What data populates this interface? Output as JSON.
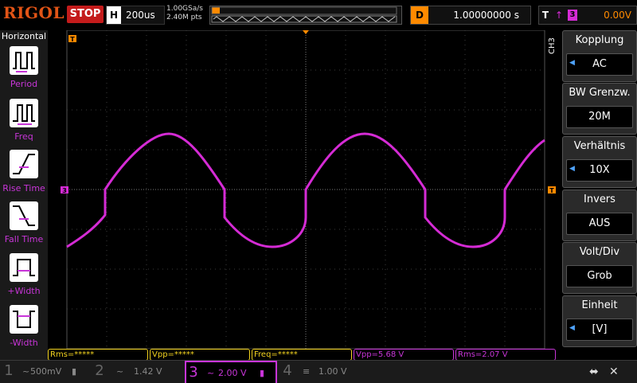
{
  "topbar": {
    "logo": "RIGOL",
    "run_state": "STOP",
    "timebase_key": "H",
    "timebase_value": "200us",
    "sample_rate": "1.00GSa/s",
    "memory_depth": "2.40M pts",
    "delay_key": "D",
    "delay_value": "1.00000000 s",
    "trigger_key": "T",
    "trigger_source": "3",
    "trigger_level": "0.00V"
  },
  "left_panel": {
    "title": "Horizontal",
    "items": [
      {
        "label": "Period",
        "icon": "period-icon"
      },
      {
        "label": "Freq",
        "icon": "freq-icon"
      },
      {
        "label": "Rise Time",
        "icon": "rise-time-icon"
      },
      {
        "label": "Fall Time",
        "icon": "fall-time-icon"
      },
      {
        "label": "+Width",
        "icon": "pos-width-icon"
      },
      {
        "label": "-Width",
        "icon": "neg-width-icon"
      }
    ]
  },
  "right_menu": {
    "channel_label": "CH3",
    "items": [
      {
        "title": "Kopplung",
        "value": "AC"
      },
      {
        "title": "BW Grenzw.",
        "value": "20M"
      },
      {
        "title": "Verhältnis",
        "value": "10X"
      },
      {
        "title": "Invers",
        "value": "AUS"
      },
      {
        "title": "Volt/Div",
        "value": "Grob"
      },
      {
        "title": "Einheit",
        "value": "[V]"
      }
    ]
  },
  "measurements": [
    {
      "text": "Rms=*****",
      "color": "#f2d21f"
    },
    {
      "text": "Vpp=*****",
      "color": "#f2d21f"
    },
    {
      "text": "Freq=*****",
      "color": "#f2d21f"
    },
    {
      "text": "Vpp=5.68 V",
      "color": "#c835d8"
    },
    {
      "text": "Rms=2.07 V",
      "color": "#c835d8"
    }
  ],
  "channels": [
    {
      "num": "1",
      "value": "500mV"
    },
    {
      "num": "2",
      "value": "1.42 V"
    },
    {
      "num": "3",
      "value": "2.00 V"
    },
    {
      "num": "4",
      "value": "1.00 V"
    }
  ],
  "markers": {
    "trigger_pos": "T",
    "ch3_ground": "3",
    "trigger_level": "T"
  },
  "colors": {
    "ch3": "#d52bd5",
    "ch4": "#4b7bff",
    "accent": "#ff8a00",
    "grid": "#3b3b3b"
  }
}
